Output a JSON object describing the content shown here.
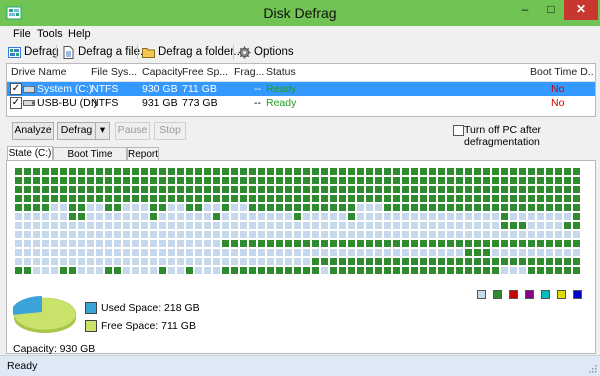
{
  "window": {
    "title": "Disk Defrag",
    "icon": "defrag-app-icon",
    "minimize": "–",
    "maximize": "□",
    "close": "✕"
  },
  "menu": [
    "File",
    "Tools",
    "Help"
  ],
  "toolbar": [
    {
      "label": "Defrag",
      "icon": "defrag-icon"
    },
    {
      "label": "Defrag a file...",
      "icon": "file-icon"
    },
    {
      "label": "Defrag a folder...",
      "icon": "folder-icon"
    },
    {
      "label": "Options",
      "icon": "gear-icon"
    }
  ],
  "drives": {
    "columns": [
      "Drive Name",
      "File Sys...",
      "Capacity",
      "Free Sp...",
      "Frag...",
      "Status",
      "Boot Time D..."
    ],
    "rows": [
      {
        "checked": true,
        "name": "System (C:)",
        "fs": "NTFS",
        "capacity": "930 GB",
        "free": "711 GB",
        "frag": "--",
        "status": "Ready",
        "boot": "No",
        "selected": true
      },
      {
        "checked": true,
        "name": "USB-BU (D:)",
        "fs": "NTFS",
        "capacity": "931 GB",
        "free": "773 GB",
        "frag": "--",
        "status": "Ready",
        "boot": "No",
        "selected": false
      }
    ]
  },
  "actions": {
    "analyze": "Analyze",
    "defrag": "Defrag",
    "dropdown": "▾",
    "pause": "Pause",
    "stop": "Stop",
    "turn_off_label": "Turn off PC after defragmentation",
    "turn_off_checked": false
  },
  "tabs": [
    "State (C:)",
    "Boot Time Defrag",
    "Report"
  ],
  "map_legend_colors": [
    "#c6d9ec",
    "#2e8b2e",
    "#cc0000",
    "#880088",
    "#00bbbb",
    "#dddd00",
    "#0000cc"
  ],
  "usage": {
    "used_label": "Used Space: 218 GB",
    "free_label": "Free Space: 711 GB",
    "capacity_label": "Capacity: 930 GB",
    "used_color": "#3aa3d8",
    "free_color": "#c9e26a"
  },
  "status": {
    "text": "Ready"
  }
}
